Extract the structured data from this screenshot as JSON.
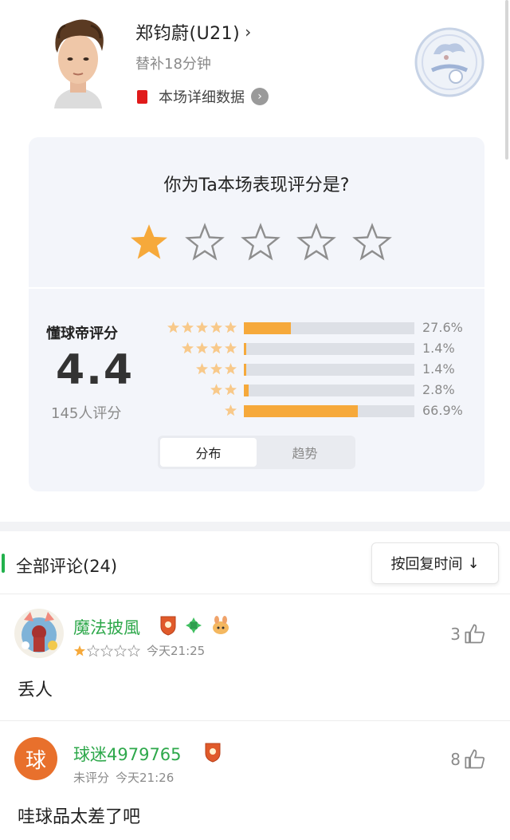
{
  "player": {
    "name": "郑钧蔚(U21)",
    "name_arrow": "›",
    "sub": "替补18分钟",
    "detail_label": "本场详细数据"
  },
  "rating": {
    "question": "你为Ta本场表现评分是?",
    "user_stars": 1,
    "total_stars": 5,
    "dq_label": "懂球帝评分",
    "score": "4.4",
    "count_text": "145人评分",
    "distribution": [
      {
        "stars": 5,
        "fraction": 0.276,
        "label": "27.6%"
      },
      {
        "stars": 4,
        "fraction": 0.014,
        "label": "1.4%"
      },
      {
        "stars": 3,
        "fraction": 0.014,
        "label": "1.4%"
      },
      {
        "stars": 2,
        "fraction": 0.028,
        "label": "2.8%"
      },
      {
        "stars": 1,
        "fraction": 0.669,
        "label": "66.9%"
      }
    ],
    "tabs": [
      "分布",
      "趋势"
    ],
    "active_tab": "分布"
  },
  "comments_section": {
    "title": "全部评论(24)",
    "sort_label": "按回复时间",
    "sort_arrow": "↓"
  },
  "comments": [
    {
      "user": "魔法披風",
      "given_stars": 1,
      "time": "今天21:25",
      "text": "丢人",
      "likes": "3"
    },
    {
      "user": "球迷4979765",
      "avatar_char": "球",
      "rating_text": "未评分",
      "time": "今天21:26",
      "text": "哇球品太差了吧",
      "likes": "8"
    }
  ],
  "colors": {
    "accent_orange": "#f6a93b",
    "username_green": "#2ea84b",
    "red_card": "#e01a1a"
  }
}
